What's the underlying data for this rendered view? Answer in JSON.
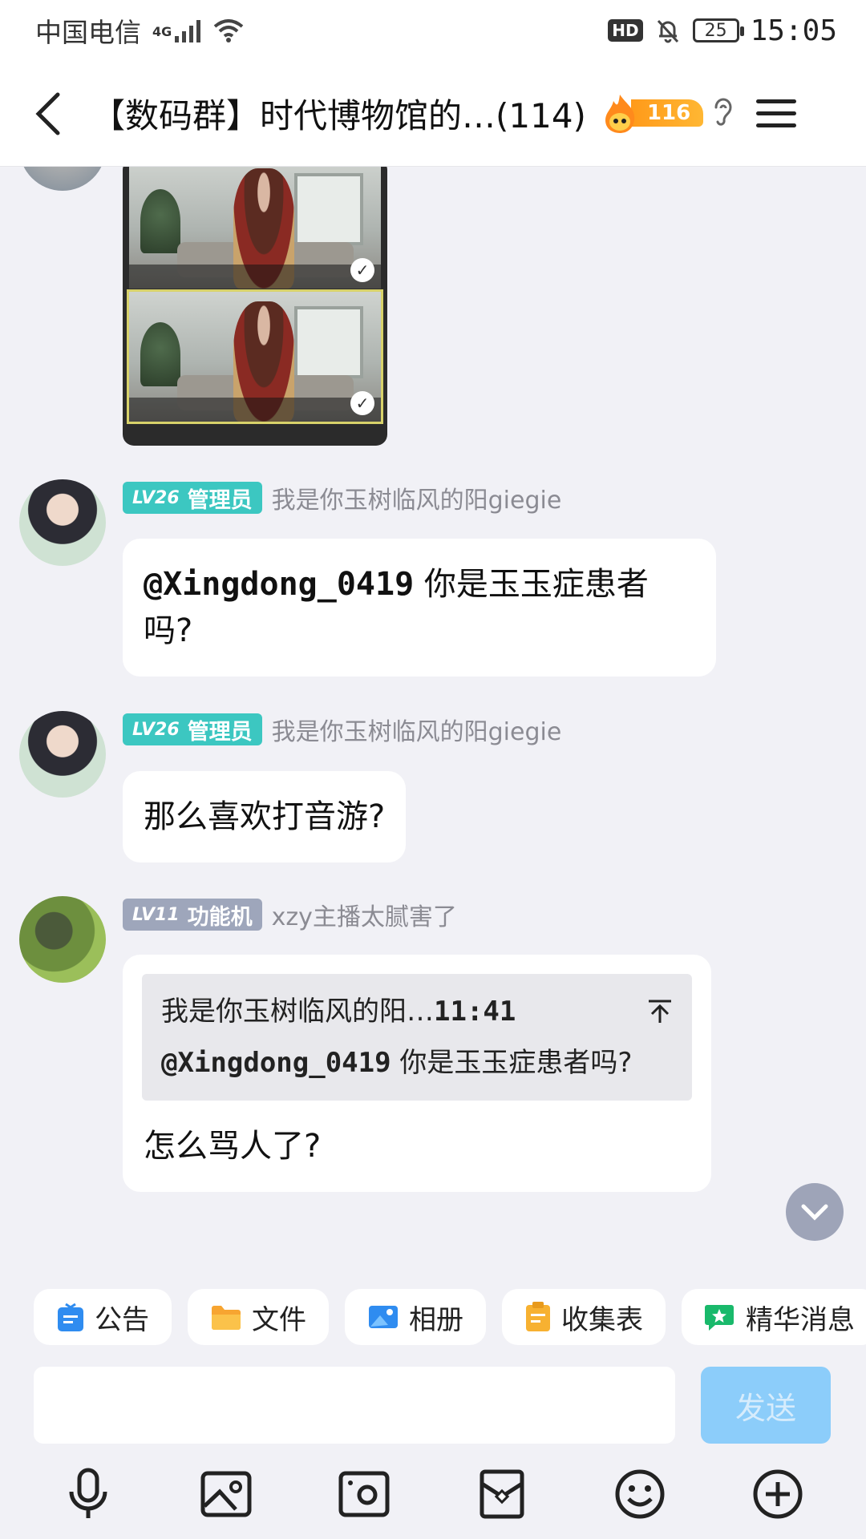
{
  "status_bar": {
    "carrier": "中国电信",
    "network": "4G",
    "battery": "25",
    "time": "15:05"
  },
  "header": {
    "title": "【数码群】时代博物馆的…(114)",
    "fire_count": "116"
  },
  "messages": [
    {
      "type": "image",
      "images": [
        "game-screenshot",
        "game-screenshot"
      ]
    },
    {
      "level": "LV26",
      "role": "管理员",
      "nickname": "我是你玉树临风的阳giegie",
      "text": "@Xingdong_0419 你是玉玉症患者吗?"
    },
    {
      "level": "LV26",
      "role": "管理员",
      "nickname": "我是你玉树临风的阳giegie",
      "text": "那么喜欢打音游?"
    },
    {
      "level": "LV11",
      "role": "功能机",
      "nickname": "xzy主播太腻害了",
      "quote": {
        "author": "我是你玉树临风的阳…",
        "time": "11:41",
        "text": "@Xingdong_0419 你是玉玉症患者吗?"
      },
      "text": "怎么骂人了?"
    }
  ],
  "toolbar": {
    "chips": [
      "公告",
      "文件",
      "相册",
      "收集表",
      "精华消息"
    ]
  },
  "input": {
    "placeholder": "",
    "send_label": "发送"
  },
  "bottom_icons": [
    "microphone-icon",
    "image-icon",
    "camera-icon",
    "red-packet-icon",
    "emoji-icon",
    "plus-icon"
  ],
  "colors": {
    "admin_badge": "#3cc7c1",
    "member_badge": "#9ea6bb",
    "send_button": "#8ccdfa",
    "background": "#f1f1f6"
  }
}
